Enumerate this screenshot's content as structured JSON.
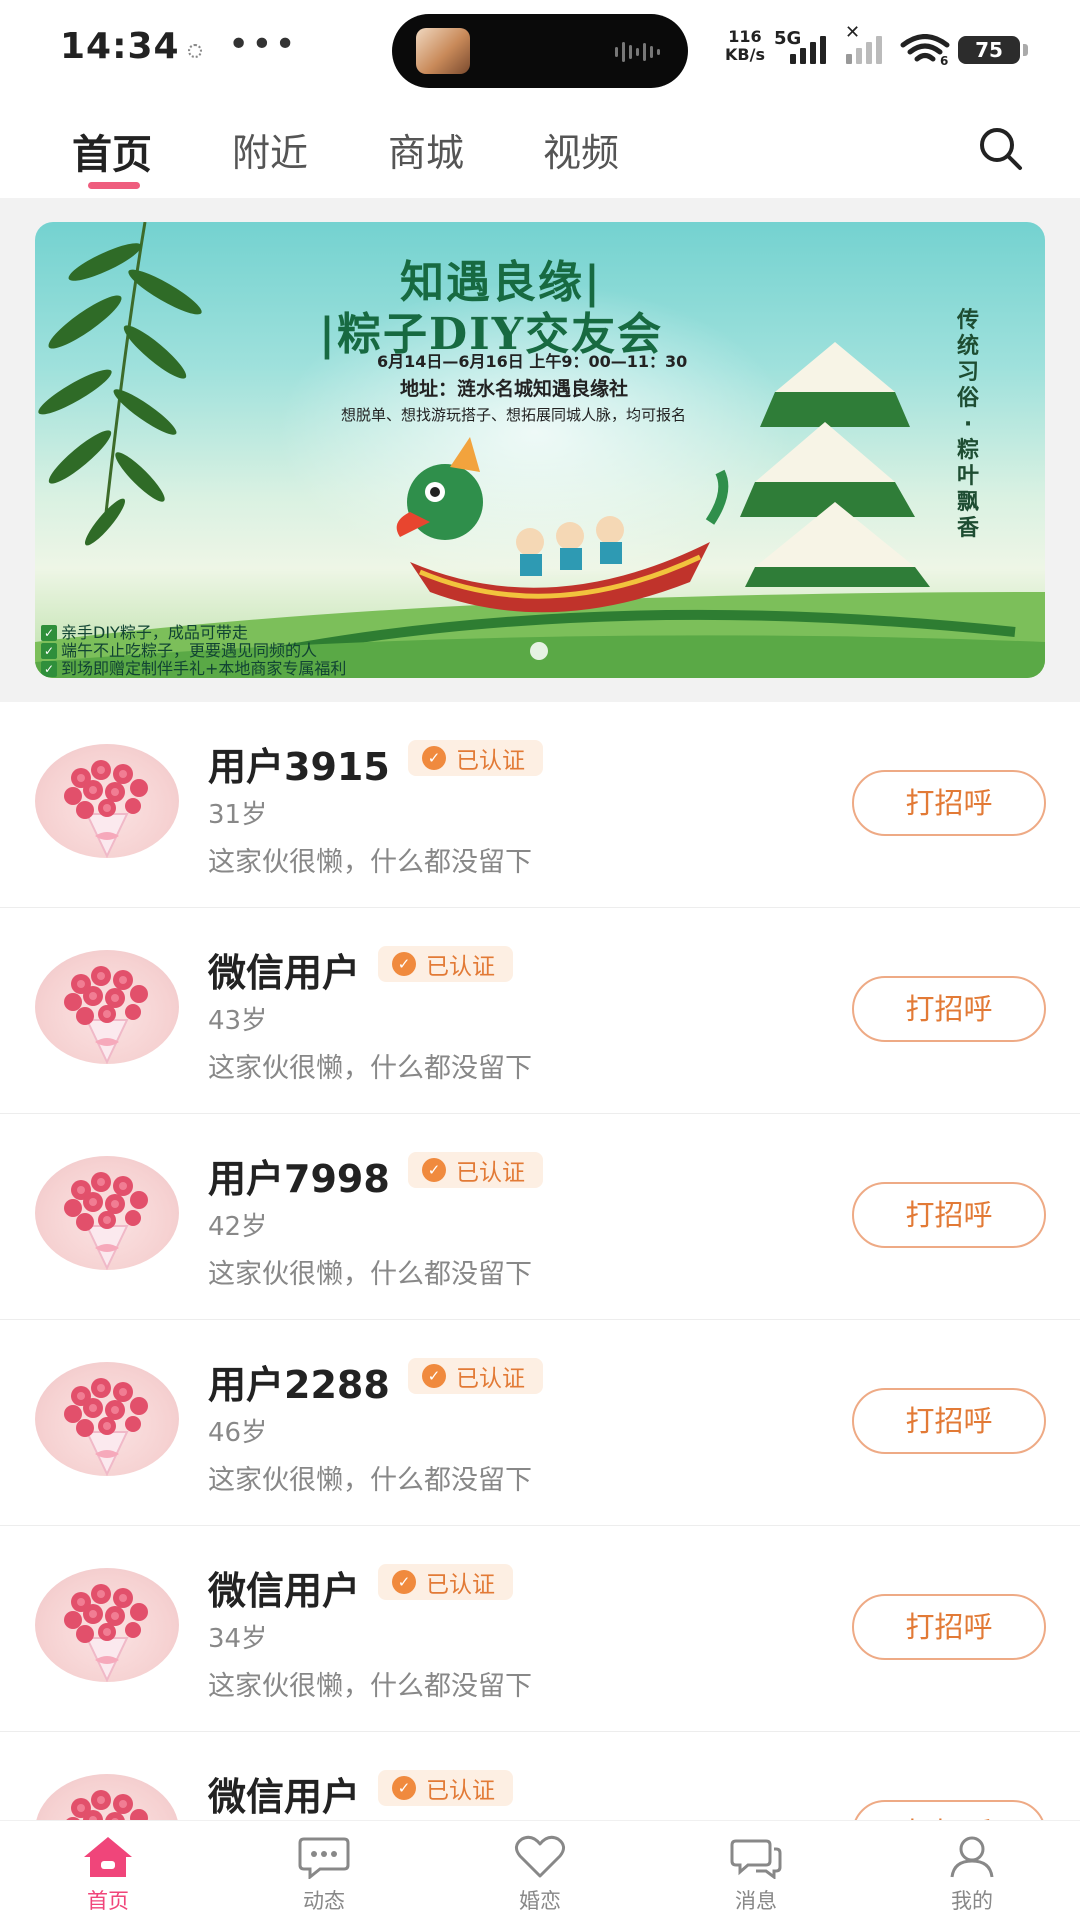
{
  "status_bar": {
    "time": "14:34",
    "more": "•••",
    "net_speed_value": "116",
    "net_speed_unit": "KB/s",
    "network_type": "5G",
    "no_signal_mark": "✕",
    "wifi_generation": "6",
    "battery": "75"
  },
  "tabs": [
    {
      "label": "首页",
      "active": true
    },
    {
      "label": "附近",
      "active": false
    },
    {
      "label": "商城",
      "active": false
    },
    {
      "label": "视频",
      "active": false
    }
  ],
  "banner": {
    "title_line1": "知遇良缘|",
    "title_line2": "|粽子DIY交友会",
    "date": "6月14日—6月16日 上午9：00—11：30",
    "address": "地址：涟水名城知遇良缘社",
    "subtitle": "想脱单、想找游玩搭子、想拓展同城人脉，均可报名",
    "vertical_text": "传统习俗·粽叶飘香",
    "features": [
      "亲手DIY粽子，成品可带走",
      "端午不止吃粽子，更要遇见同频的人",
      "到场即赠定制伴手礼+本地商家专属福利"
    ],
    "slide_index": 1
  },
  "users": [
    {
      "name": "用户3915",
      "badge": "已认证",
      "age": "31岁",
      "bio": "这家伙很懒，什么都没留下",
      "action": "打招呼"
    },
    {
      "name": "微信用户",
      "badge": "已认证",
      "age": "43岁",
      "bio": "这家伙很懒，什么都没留下",
      "action": "打招呼"
    },
    {
      "name": "用户7998",
      "badge": "已认证",
      "age": "42岁",
      "bio": "这家伙很懒，什么都没留下",
      "action": "打招呼"
    },
    {
      "name": "用户2288",
      "badge": "已认证",
      "age": "46岁",
      "bio": "这家伙很懒，什么都没留下",
      "action": "打招呼"
    },
    {
      "name": "微信用户",
      "badge": "已认证",
      "age": "34岁",
      "bio": "这家伙很懒，什么都没留下",
      "action": "打招呼"
    },
    {
      "name": "微信用户",
      "badge": "已认证",
      "age": "",
      "bio": "",
      "action": "打招呼"
    }
  ],
  "bottom_nav": [
    {
      "label": "首页",
      "icon": "home-icon",
      "active": true
    },
    {
      "label": "动态",
      "icon": "chat-bubble-icon",
      "active": false
    },
    {
      "label": "婚恋",
      "icon": "heart-icon",
      "active": false
    },
    {
      "label": "消息",
      "icon": "messages-icon",
      "active": false
    },
    {
      "label": "我的",
      "icon": "user-icon",
      "active": false
    }
  ],
  "colors": {
    "accent_pink": "#ef5d7e",
    "nav_active": "#f0457a",
    "badge_orange": "#e27a36",
    "badge_bg": "#fdefe3",
    "button_border": "#eeaa85",
    "banner_green": "#176a41"
  }
}
